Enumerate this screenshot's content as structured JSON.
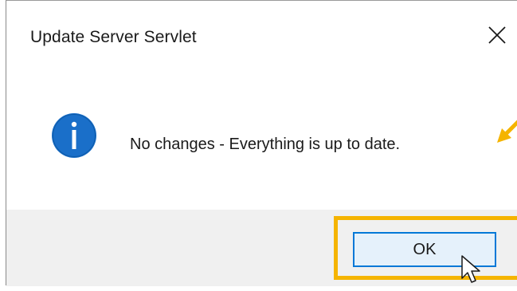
{
  "dialog": {
    "title": "Update Server Servlet",
    "message": "No changes - Everything is up to date.",
    "icon": "info-icon",
    "ok_label": "OK"
  },
  "colors": {
    "info_icon": "#1a6fc9",
    "button_border": "#0078d7",
    "button_fill": "#e5f1fb",
    "highlight": "#f5b400",
    "footer_bg": "#f0f0f0"
  }
}
